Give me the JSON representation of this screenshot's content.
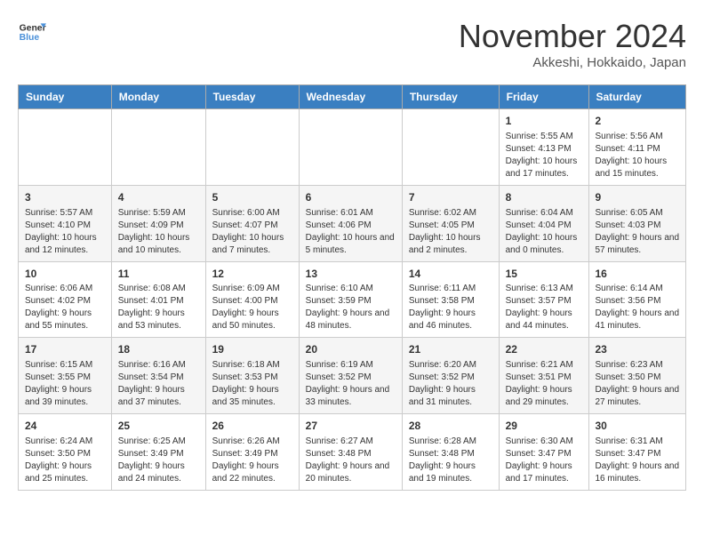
{
  "logo": {
    "line1": "General",
    "line2": "Blue"
  },
  "title": "November 2024",
  "location": "Akkeshi, Hokkaido, Japan",
  "days_of_week": [
    "Sunday",
    "Monday",
    "Tuesday",
    "Wednesday",
    "Thursday",
    "Friday",
    "Saturday"
  ],
  "weeks": [
    [
      {
        "day": "",
        "info": ""
      },
      {
        "day": "",
        "info": ""
      },
      {
        "day": "",
        "info": ""
      },
      {
        "day": "",
        "info": ""
      },
      {
        "day": "",
        "info": ""
      },
      {
        "day": "1",
        "info": "Sunrise: 5:55 AM\nSunset: 4:13 PM\nDaylight: 10 hours and 17 minutes."
      },
      {
        "day": "2",
        "info": "Sunrise: 5:56 AM\nSunset: 4:11 PM\nDaylight: 10 hours and 15 minutes."
      }
    ],
    [
      {
        "day": "3",
        "info": "Sunrise: 5:57 AM\nSunset: 4:10 PM\nDaylight: 10 hours and 12 minutes."
      },
      {
        "day": "4",
        "info": "Sunrise: 5:59 AM\nSunset: 4:09 PM\nDaylight: 10 hours and 10 minutes."
      },
      {
        "day": "5",
        "info": "Sunrise: 6:00 AM\nSunset: 4:07 PM\nDaylight: 10 hours and 7 minutes."
      },
      {
        "day": "6",
        "info": "Sunrise: 6:01 AM\nSunset: 4:06 PM\nDaylight: 10 hours and 5 minutes."
      },
      {
        "day": "7",
        "info": "Sunrise: 6:02 AM\nSunset: 4:05 PM\nDaylight: 10 hours and 2 minutes."
      },
      {
        "day": "8",
        "info": "Sunrise: 6:04 AM\nSunset: 4:04 PM\nDaylight: 10 hours and 0 minutes."
      },
      {
        "day": "9",
        "info": "Sunrise: 6:05 AM\nSunset: 4:03 PM\nDaylight: 9 hours and 57 minutes."
      }
    ],
    [
      {
        "day": "10",
        "info": "Sunrise: 6:06 AM\nSunset: 4:02 PM\nDaylight: 9 hours and 55 minutes."
      },
      {
        "day": "11",
        "info": "Sunrise: 6:08 AM\nSunset: 4:01 PM\nDaylight: 9 hours and 53 minutes."
      },
      {
        "day": "12",
        "info": "Sunrise: 6:09 AM\nSunset: 4:00 PM\nDaylight: 9 hours and 50 minutes."
      },
      {
        "day": "13",
        "info": "Sunrise: 6:10 AM\nSunset: 3:59 PM\nDaylight: 9 hours and 48 minutes."
      },
      {
        "day": "14",
        "info": "Sunrise: 6:11 AM\nSunset: 3:58 PM\nDaylight: 9 hours and 46 minutes."
      },
      {
        "day": "15",
        "info": "Sunrise: 6:13 AM\nSunset: 3:57 PM\nDaylight: 9 hours and 44 minutes."
      },
      {
        "day": "16",
        "info": "Sunrise: 6:14 AM\nSunset: 3:56 PM\nDaylight: 9 hours and 41 minutes."
      }
    ],
    [
      {
        "day": "17",
        "info": "Sunrise: 6:15 AM\nSunset: 3:55 PM\nDaylight: 9 hours and 39 minutes."
      },
      {
        "day": "18",
        "info": "Sunrise: 6:16 AM\nSunset: 3:54 PM\nDaylight: 9 hours and 37 minutes."
      },
      {
        "day": "19",
        "info": "Sunrise: 6:18 AM\nSunset: 3:53 PM\nDaylight: 9 hours and 35 minutes."
      },
      {
        "day": "20",
        "info": "Sunrise: 6:19 AM\nSunset: 3:52 PM\nDaylight: 9 hours and 33 minutes."
      },
      {
        "day": "21",
        "info": "Sunrise: 6:20 AM\nSunset: 3:52 PM\nDaylight: 9 hours and 31 minutes."
      },
      {
        "day": "22",
        "info": "Sunrise: 6:21 AM\nSunset: 3:51 PM\nDaylight: 9 hours and 29 minutes."
      },
      {
        "day": "23",
        "info": "Sunrise: 6:23 AM\nSunset: 3:50 PM\nDaylight: 9 hours and 27 minutes."
      }
    ],
    [
      {
        "day": "24",
        "info": "Sunrise: 6:24 AM\nSunset: 3:50 PM\nDaylight: 9 hours and 25 minutes."
      },
      {
        "day": "25",
        "info": "Sunrise: 6:25 AM\nSunset: 3:49 PM\nDaylight: 9 hours and 24 minutes."
      },
      {
        "day": "26",
        "info": "Sunrise: 6:26 AM\nSunset: 3:49 PM\nDaylight: 9 hours and 22 minutes."
      },
      {
        "day": "27",
        "info": "Sunrise: 6:27 AM\nSunset: 3:48 PM\nDaylight: 9 hours and 20 minutes."
      },
      {
        "day": "28",
        "info": "Sunrise: 6:28 AM\nSunset: 3:48 PM\nDaylight: 9 hours and 19 minutes."
      },
      {
        "day": "29",
        "info": "Sunrise: 6:30 AM\nSunset: 3:47 PM\nDaylight: 9 hours and 17 minutes."
      },
      {
        "day": "30",
        "info": "Sunrise: 6:31 AM\nSunset: 3:47 PM\nDaylight: 9 hours and 16 minutes."
      }
    ]
  ]
}
